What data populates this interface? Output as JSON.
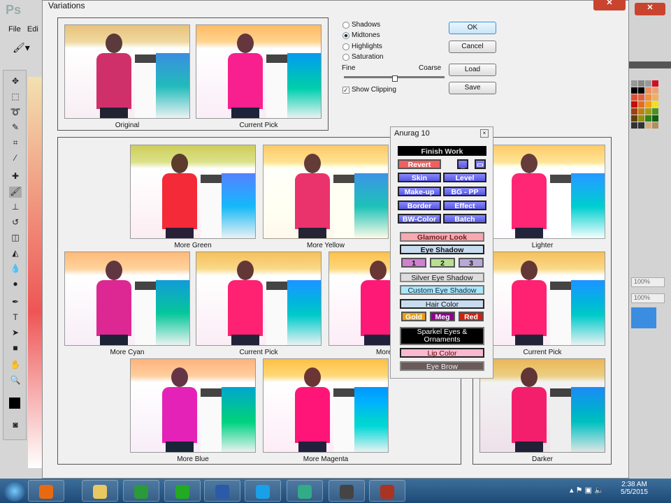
{
  "photoshop": {
    "logo": "Ps",
    "menu": [
      "File",
      "Edi"
    ]
  },
  "dialog": {
    "title": "Variations",
    "top": {
      "original_label": "Original",
      "current_label": "Current Pick"
    },
    "radios": [
      {
        "label": "Shadows",
        "checked": false
      },
      {
        "label": "Midtones",
        "checked": true
      },
      {
        "label": "Highlights",
        "checked": false
      },
      {
        "label": "Saturation",
        "checked": false
      }
    ],
    "slider": {
      "fine": "Fine",
      "coarse": "Coarse",
      "value_fraction": 0.5
    },
    "show_clipping": {
      "label": "Show Clipping",
      "checked": true
    },
    "buttons": {
      "ok": "OK",
      "cancel": "Cancel",
      "load": "Load",
      "save": "Save"
    },
    "variations": [
      "More Green",
      "More Yellow",
      "More Cyan",
      "Current Pick",
      "More Red",
      "More Blue",
      "More Magenta"
    ],
    "brightness": [
      "Lighter",
      "Current Pick",
      "Darker"
    ]
  },
  "anurag": {
    "title": "Anurag 10",
    "finish": "Finish Work",
    "revert": "Revert",
    "grid": [
      "Skin",
      "Level",
      "Make-up",
      "BG - PP",
      "Border",
      "Effect",
      "BW-Color",
      "Batch"
    ],
    "glamour": "Glamour Look",
    "eye_shadow": "Eye Shadow",
    "eye_nums": [
      "1",
      "2",
      "3"
    ],
    "silver": "Silver Eye Shadow",
    "custom": "Custom Eye Shadow",
    "hair": "Hair Color",
    "hair_opts": [
      "Gold",
      "Meg",
      "Red"
    ],
    "sparkel": "Sparkel Eyes & Ornaments",
    "lip": "Lip Color",
    "brow": "Eye Brow"
  },
  "right_panel": {
    "zoom1": "100%",
    "zoom2": "100%"
  },
  "taskbar": {
    "time": "2:38 AM",
    "date": "5/5/2015"
  }
}
